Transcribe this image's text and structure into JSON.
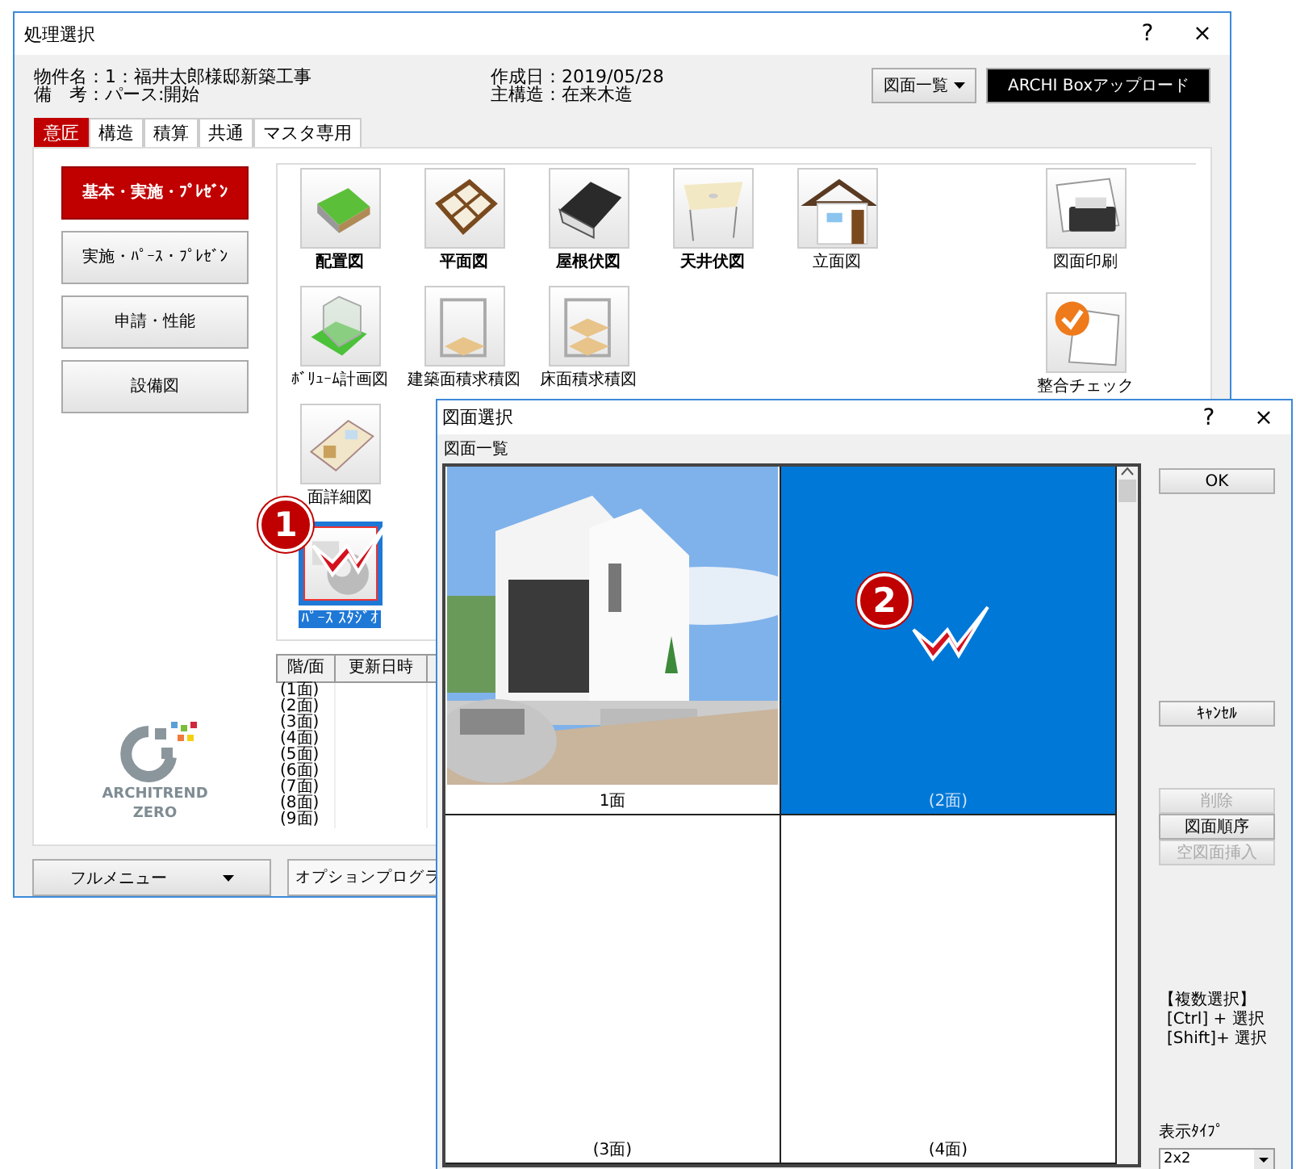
{
  "main_window": {
    "title": "処理選択",
    "help": "?",
    "close": "×",
    "info_left": [
      "物件名：1：福井太郎様邸新築工事",
      "備　考：パース:開始"
    ],
    "info_right": [
      "作成日：2019/05/28",
      "主構造：在来木造"
    ],
    "list_button": "図面一覧",
    "upload_button": "ARCHI Boxアップロード",
    "tabs": [
      {
        "label": "意匠",
        "selected": true
      },
      {
        "label": "構造",
        "selected": false
      },
      {
        "label": "積算",
        "selected": false
      },
      {
        "label": "共通",
        "selected": false
      },
      {
        "label": "マスタ専用",
        "selected": false
      }
    ],
    "categories": [
      {
        "label": "基本・実施・ﾌﾟﾚｾﾞﾝ",
        "selected": true
      },
      {
        "label": "実施・ﾊﾟｰｽ・ﾌﾟﾚｾﾞﾝ",
        "selected": false
      },
      {
        "label": "申請・性能",
        "selected": false
      },
      {
        "label": "設備図",
        "selected": false
      }
    ],
    "tool_rows": [
      [
        {
          "kind": "site",
          "label": "配置図",
          "emphasized": true,
          "selected": false
        },
        {
          "kind": "plan",
          "label": "平面図",
          "emphasized": true,
          "selected": false
        },
        {
          "kind": "roof",
          "label": "屋根伏図",
          "emphasized": true,
          "selected": false
        },
        {
          "kind": "ceiling",
          "label": "天井伏図",
          "emphasized": true,
          "selected": false
        },
        {
          "kind": "elevation",
          "label": "立面図",
          "emphasized": false,
          "selected": false
        }
      ],
      [
        {
          "kind": "volume",
          "label": "ﾎﾞﾘｭｰﾑ計画図",
          "emphasized": false,
          "selected": false
        },
        {
          "kind": "frame",
          "label": "建築面積求積図",
          "emphasized": false,
          "selected": false
        },
        {
          "kind": "floors",
          "label": "床面積求積図",
          "emphasized": false,
          "selected": false
        }
      ],
      [
        {
          "kind": "detail",
          "label": "面詳細図",
          "emphasized": false,
          "selected": false
        }
      ],
      [
        {
          "kind": "perspective",
          "label": "ﾊﾟｰｽ ｽﾀｼﾞｵ",
          "emphasized": false,
          "selected": true
        }
      ]
    ],
    "output_tools": [
      {
        "kind": "print",
        "label": "図面印刷",
        "selected": false
      },
      {
        "kind": "check",
        "label": "整合チェック",
        "selected": false
      }
    ],
    "floor_table": {
      "columns": [
        "階/面",
        "更新日時"
      ],
      "rows": [
        "(1面)",
        "(2面)",
        "(3面)",
        "(4面)",
        "(5面)",
        "(6面)",
        "(7面)",
        "(8面)",
        "(9面)"
      ]
    },
    "logo": {
      "line1": "ARCHITREND",
      "line2": "ZERO"
    },
    "full_menu_button": "フルメニュー",
    "option_button": "オプションプログラ",
    "step_badge": "1"
  },
  "dialog": {
    "title": "図面選択",
    "help": "?",
    "close": "×",
    "list_label": "図面一覧",
    "sheets": [
      {
        "caption": "1面",
        "kind": "picture",
        "selected": false
      },
      {
        "caption": "(2面)",
        "selected": true
      },
      {
        "caption": "(3面)",
        "selected": false
      },
      {
        "caption": "(4面)",
        "selected": false
      }
    ],
    "step_badge": "2",
    "ok_button": "OK",
    "cancel_button": "ｷｬﾝｾﾙ",
    "edit_buttons": [
      {
        "label": "削除",
        "disabled": true
      },
      {
        "label": "図面順序",
        "disabled": false
      },
      {
        "label": "空図面挿入",
        "disabled": true
      }
    ],
    "hint_title": "【複数選択】",
    "hints": [
      "[Ctrl] + 選択",
      "[Shift]+ 選択"
    ],
    "display_type_label": "表示ﾀｲﾌﾟ",
    "display_type": "2x2"
  }
}
